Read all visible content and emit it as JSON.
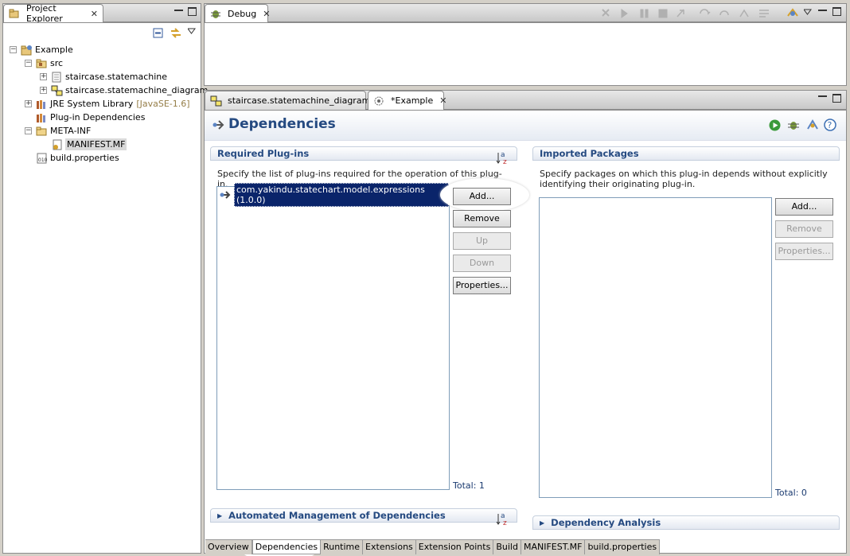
{
  "project_explorer": {
    "title": "Project Explorer",
    "tree": [
      {
        "label": "Example",
        "expander": "−"
      },
      {
        "label": "src",
        "expander": "−"
      },
      {
        "label": "staircase.statemachine",
        "expander": "+"
      },
      {
        "label": "staircase.statemachine_diagram",
        "expander": "+"
      },
      {
        "label": "JRE System Library",
        "suffix": "[JavaSE-1.6]",
        "expander": "+"
      },
      {
        "label": "Plug-in Dependencies",
        "expander": ""
      },
      {
        "label": "META-INF",
        "expander": "−"
      },
      {
        "label": "MANIFEST.MF",
        "expander": ""
      },
      {
        "label": "build.properties",
        "expander": ""
      }
    ]
  },
  "debug": {
    "title": "Debug"
  },
  "editor_tabs": [
    {
      "label": "staircase.statemachine_diagram"
    },
    {
      "label": "*Example"
    }
  ],
  "form": {
    "title": "Dependencies",
    "required": {
      "heading": "Required Plug-ins",
      "description": "Specify the list of plug-ins required for the operation of this plug-in.",
      "items": [
        "com.yakindu.statechart.model.expressions (1.0.0)"
      ],
      "buttons": {
        "add": "Add...",
        "remove": "Remove",
        "up": "Up",
        "down": "Down",
        "properties": "Properties..."
      },
      "total": "Total: 1"
    },
    "imported": {
      "heading": "Imported Packages",
      "description": "Specify packages on which this plug-in depends without explicitly identifying their originating plug-in.",
      "buttons": {
        "add": "Add...",
        "remove": "Remove",
        "properties": "Properties..."
      },
      "total": "Total: 0"
    },
    "automated": {
      "heading": "Automated Management of Dependencies"
    },
    "analysis": {
      "heading": "Dependency Analysis"
    }
  },
  "bottom_tabs": [
    "Overview",
    "Dependencies",
    "Runtime",
    "Extensions",
    "Extension Points",
    "Build",
    "MANIFEST.MF",
    "build.properties"
  ],
  "colors": {
    "accent": "#254a81",
    "selection": "#0a246a"
  },
  "icons": {
    "explorer": "project-explorer-icon",
    "debug": "debug-icon",
    "sort": "sort-az-icon",
    "run": "run-icon",
    "bug": "debug-launch-icon",
    "help": "help-icon"
  }
}
